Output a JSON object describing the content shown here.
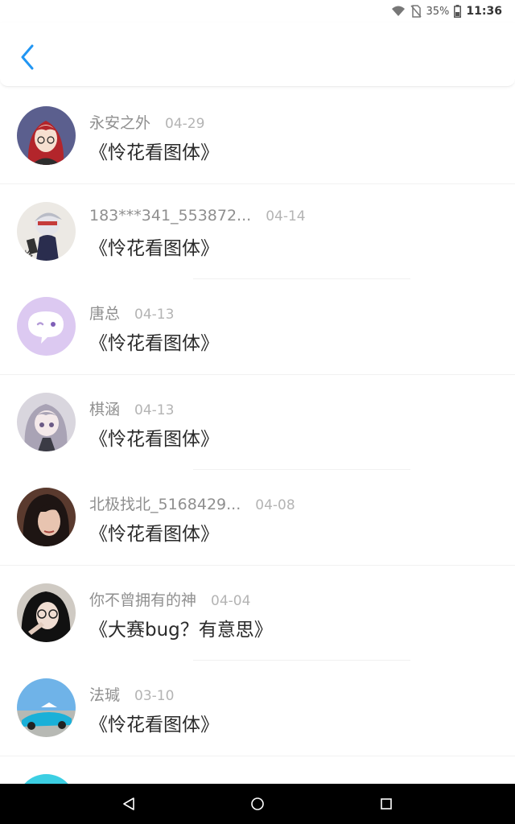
{
  "status_bar": {
    "battery_percent": "35%",
    "time": "11:36",
    "icons": [
      "wifi-icon",
      "no-sim-icon",
      "battery-icon"
    ]
  },
  "header": {
    "back_icon": "chevron-left-icon",
    "accent_color": "#2196f3"
  },
  "messages": [
    {
      "name": "永安之外",
      "date": "04-29",
      "message": "《怜花看图体》",
      "avatar": "avatar-red-hair-anime"
    },
    {
      "name": "183***341_553872...",
      "date": "04-14",
      "message": "《怜花看图体》",
      "avatar": "avatar-white-hair-anime"
    },
    {
      "name": "唐总",
      "date": "04-13",
      "message": "《怜花看图体》",
      "avatar": "avatar-default-chat-bubble"
    },
    {
      "name": "棋涵",
      "date": "04-13",
      "message": "《怜花看图体》",
      "avatar": "avatar-silver-hair-anime"
    },
    {
      "name": "北极找北_5168429...",
      "date": "04-08",
      "message": "《怜花看图体》",
      "avatar": "avatar-photo-dark-hair"
    },
    {
      "name": "你不曾拥有的神",
      "date": "04-04",
      "message": "《大赛bug？有意思》",
      "avatar": "avatar-photo-girl"
    },
    {
      "name": "法瑊",
      "date": "03-10",
      "message": "《怜花看图体》",
      "avatar": "avatar-blue-car"
    }
  ],
  "nav_bar": {
    "icons": [
      "back-triangle-icon",
      "home-circle-icon",
      "recents-square-icon"
    ]
  }
}
